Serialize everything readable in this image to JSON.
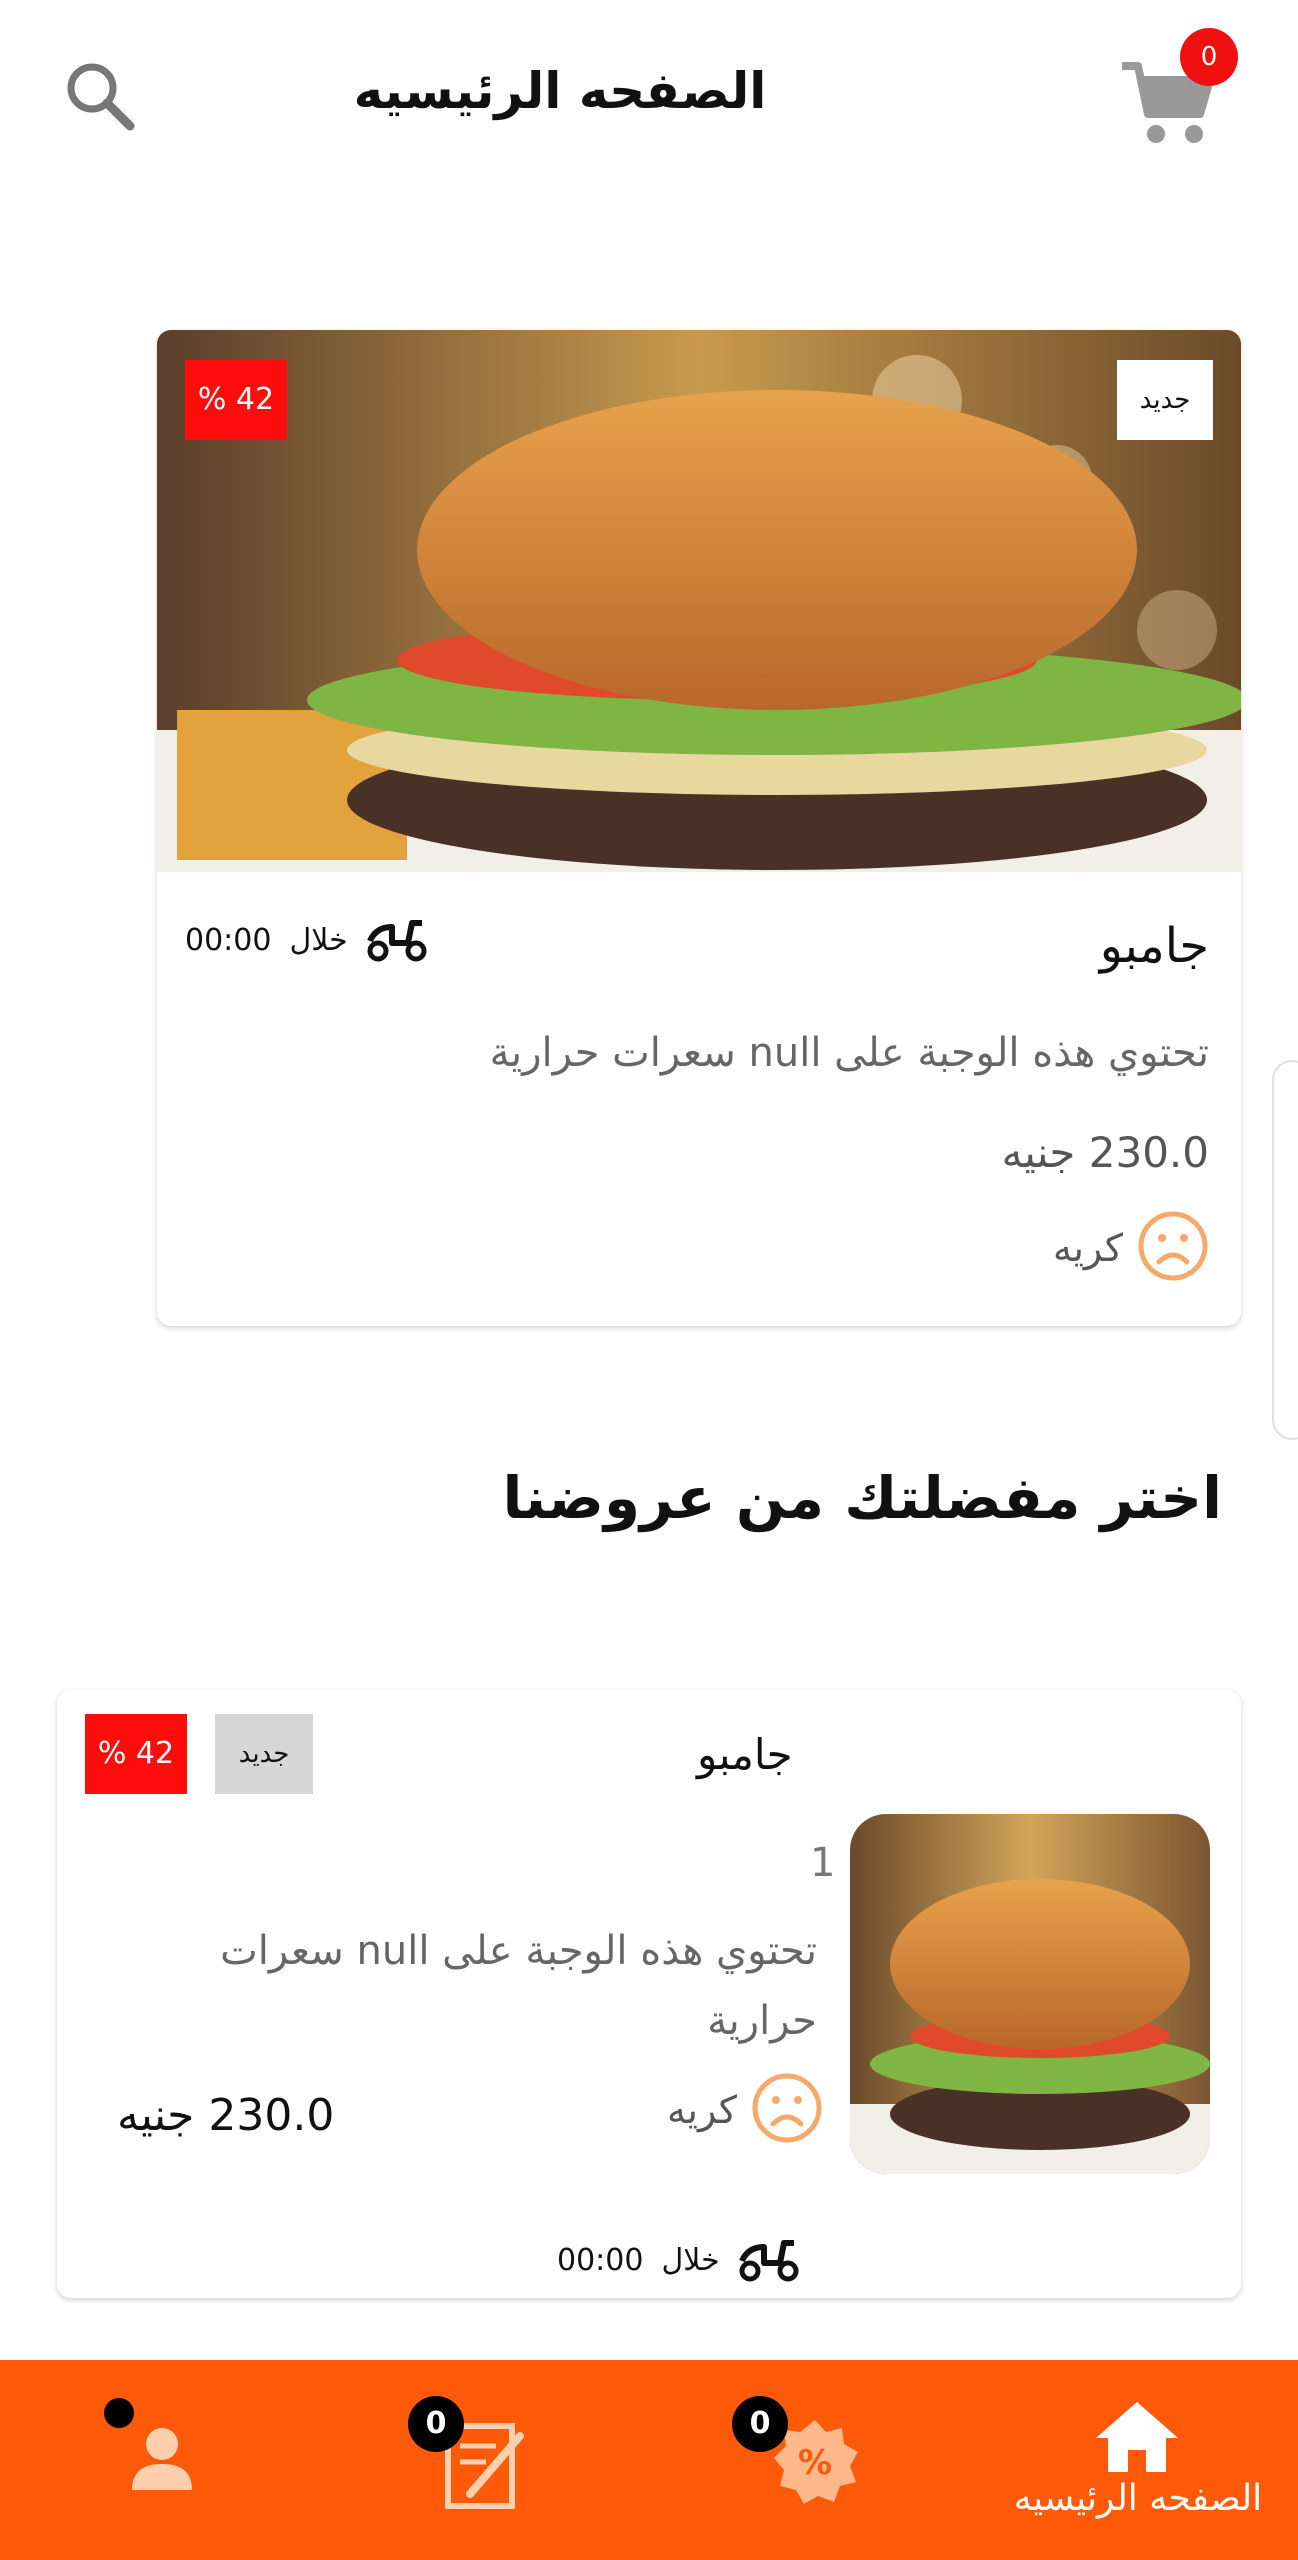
{
  "header": {
    "title": "الصفحه الرئيسيه",
    "cart_count": "0",
    "search_icon": "search-icon",
    "cart_icon": "cart-icon"
  },
  "featured": {
    "new_tag": "جديد",
    "discount": "% 42",
    "name": "جامبو",
    "delivery_word": "خلال",
    "delivery_time": "00:00",
    "description": "تحتوي هذه الوجبة على null سعرات حرارية",
    "price": "230.0 جنيه",
    "rating": "كريه"
  },
  "section": {
    "title": "اختر مفضلتك من عروضنا"
  },
  "offer": {
    "name": "جامبو",
    "new_tag": "جديد",
    "discount": "% 42",
    "quantity": "1",
    "description": "تحتوي هذه الوجبة على null سعرات حرارية",
    "rating": "كريه",
    "price": "230.0 جنيه",
    "delivery_word": "خلال",
    "delivery_time": "00:00"
  },
  "bottom_nav": {
    "home_label": "الصفحه الرئيسيه",
    "offers_count": "0",
    "orders_count": "0"
  },
  "colors": {
    "accent": "#ff5a0a",
    "discount_red": "#ff0d0d",
    "sad_face": "#f7a96a"
  }
}
